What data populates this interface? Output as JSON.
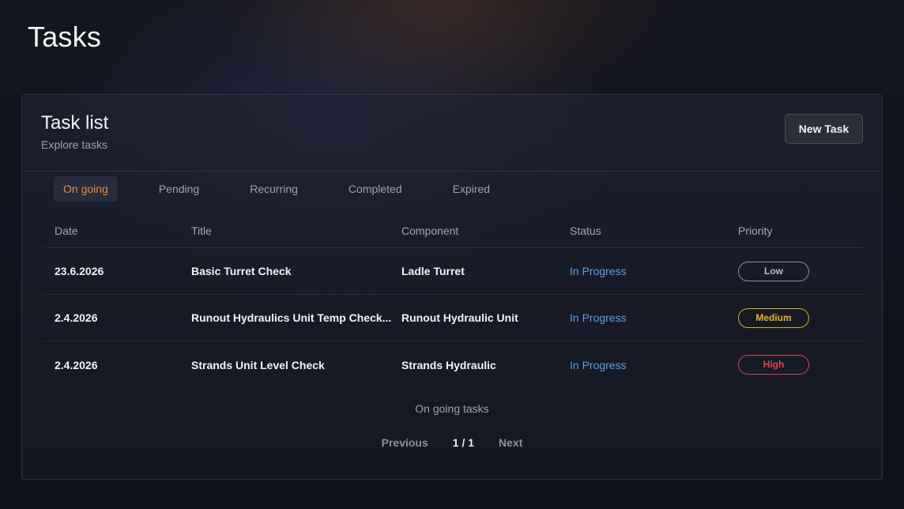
{
  "page": {
    "title": "Tasks"
  },
  "card": {
    "title": "Task list",
    "subtitle": "Explore tasks",
    "new_task_label": "New Task"
  },
  "tabs": [
    {
      "label": "On going",
      "active": true
    },
    {
      "label": "Pending",
      "active": false
    },
    {
      "label": "Recurring",
      "active": false
    },
    {
      "label": "Completed",
      "active": false
    },
    {
      "label": "Expired",
      "active": false
    }
  ],
  "table": {
    "columns": [
      "Date",
      "Title",
      "Component",
      "Status",
      "Priority"
    ],
    "rows": [
      {
        "date": "23.6.2026",
        "title": "Basic Turret Check",
        "component": "Ladle Turret",
        "status": "In Progress",
        "priority": "Low"
      },
      {
        "date": "2.4.2026",
        "title": "Runout Hydraulics Unit Temp Check...",
        "component": "Runout Hydraulic Unit",
        "status": "In Progress",
        "priority": "Medium"
      },
      {
        "date": "2.4.2026",
        "title": "Strands Unit Level Check",
        "component": "Strands Hydraulic",
        "status": "In Progress",
        "priority": "High"
      }
    ]
  },
  "footer": {
    "label": "On going tasks",
    "previous_label": "Previous",
    "page_indicator": "1 / 1",
    "next_label": "Next"
  },
  "colors": {
    "active_tab": "#e9893a",
    "status_in_progress": "#5b9ee6",
    "priority_low": "#b9bdc7",
    "priority_medium": "#e2b62b",
    "priority_high": "#e0474d"
  }
}
